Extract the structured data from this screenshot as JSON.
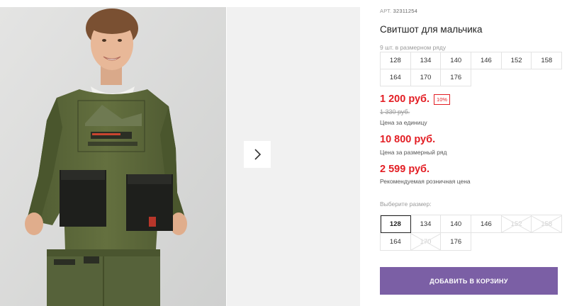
{
  "product": {
    "article_label": "АРТ.",
    "article_value": "32311254",
    "title": "Свитшот для мальчика"
  },
  "pack": {
    "note": "9 шт. в размерном ряду",
    "sizes": [
      "128",
      "134",
      "140",
      "146",
      "152",
      "158",
      "164",
      "170",
      "176"
    ]
  },
  "prices": {
    "unit_price": "1 200 руб.",
    "discount_badge": "10%",
    "old_price": "1 330 руб.",
    "unit_caption": "Цена за единицу",
    "pack_price": "10 800 руб.",
    "pack_caption": "Цена за размерный ряд",
    "retail_price": "2 599 руб.",
    "retail_caption": "Рекомендуемая розничная цена"
  },
  "size_select": {
    "label": "Выберите размер:",
    "selected": "128",
    "options": [
      {
        "value": "128",
        "available": true
      },
      {
        "value": "134",
        "available": true
      },
      {
        "value": "140",
        "available": true
      },
      {
        "value": "146",
        "available": true
      },
      {
        "value": "152",
        "available": false
      },
      {
        "value": "158",
        "available": false
      },
      {
        "value": "164",
        "available": true
      },
      {
        "value": "170",
        "available": false
      },
      {
        "value": "176",
        "available": true
      }
    ]
  },
  "actions": {
    "add_to_cart": "ДОБАВИТЬ В КОРЗИНУ"
  },
  "gallery": {
    "next_icon": "chevron-right-icon"
  },
  "colors": {
    "price_red": "#e31e24",
    "button_purple": "#7b5fa5",
    "sweatshirt_olive": "#5d6a3c"
  }
}
